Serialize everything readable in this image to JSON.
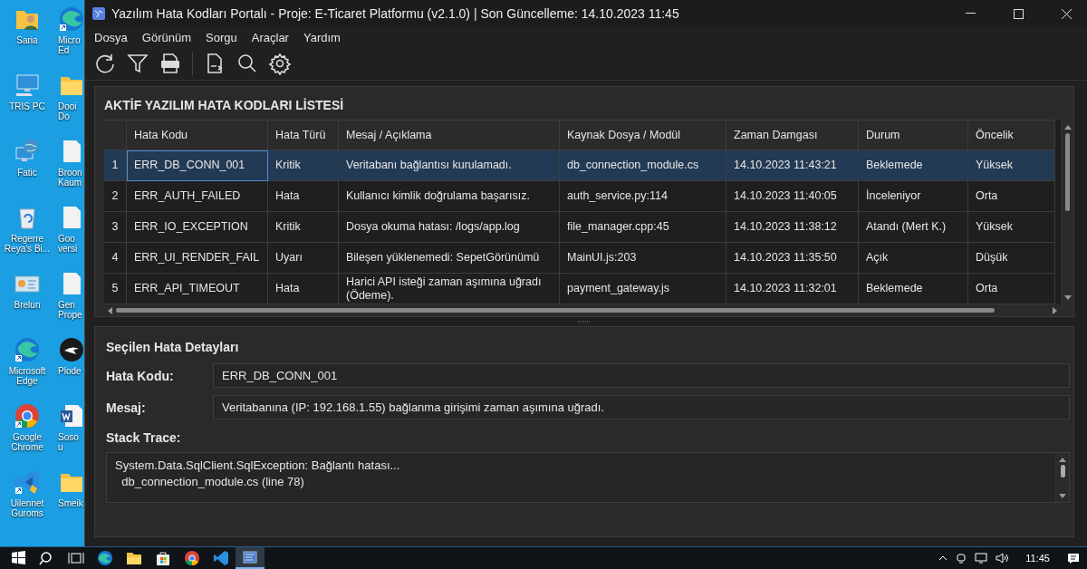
{
  "desktop": {
    "icons": [
      {
        "label": "Saria",
        "kind": "user-folder"
      },
      {
        "label": "Micro Ed",
        "kind": "edge"
      },
      {
        "label": "TRIS PC",
        "kind": "computer"
      },
      {
        "label": "Dooi Do",
        "kind": "folder"
      },
      {
        "label": "Fatic",
        "kind": "network"
      },
      {
        "label": "Broon Kaum",
        "kind": "document"
      },
      {
        "label": "Regerre Reya's Bi...",
        "kind": "recycle-bin"
      },
      {
        "label": "Goo versi",
        "kind": "document"
      },
      {
        "label": "Brelun",
        "kind": "control-panel"
      },
      {
        "label": "Gen Prope",
        "kind": "document"
      },
      {
        "label": "Microsoft Edge",
        "kind": "edge"
      },
      {
        "label": "Plode",
        "kind": "dark-app"
      },
      {
        "label": "Google Chrome",
        "kind": "chrome"
      },
      {
        "label": "Sosou",
        "kind": "word"
      },
      {
        "label": "Uilennet Guroms",
        "kind": "vscode"
      },
      {
        "label": "Smeik",
        "kind": "folder"
      }
    ]
  },
  "window": {
    "title": "Yazılım Hata Kodları Portalı - Proje: E-Ticaret Platformu (v2.1.0) | Son Güncelleme: 14.10.2023 11:45",
    "menu": [
      "Dosya",
      "Görünüm",
      "Sorgu",
      "Araçlar",
      "Yardım"
    ],
    "toolbar": [
      {
        "kind": "refresh"
      },
      {
        "kind": "filter"
      },
      {
        "kind": "pdf"
      },
      {
        "kind": "separator"
      },
      {
        "kind": "export"
      },
      {
        "kind": "search"
      },
      {
        "kind": "settings"
      }
    ]
  },
  "error_list": {
    "title": "AKTİF YAZILIM HATA KODLARI LİSTESİ",
    "columns": [
      "Hata Kodu",
      "Hata Türü",
      "Mesaj / Açıklama",
      "Kaynak Dosya / Modül",
      "Zaman Damgası",
      "Durum",
      "Öncelik"
    ],
    "rows": [
      {
        "index": "1",
        "cells": [
          "ERR_DB_CONN_001",
          "Kritik",
          "Veritabanı bağlantısı kurulamadı.",
          "db_connection_module.cs",
          "14.10.2023 11:43:21",
          "Beklemede",
          "Yüksek"
        ],
        "selected": true
      },
      {
        "index": "2",
        "cells": [
          "ERR_AUTH_FAILED",
          "Hata",
          "Kullanıcı kimlik doğrulama başarısız.",
          "auth_service.py:114",
          "14.10.2023 11:40:05",
          "İnceleniyor",
          "Orta"
        ],
        "selected": false
      },
      {
        "index": "3",
        "cells": [
          "ERR_IO_EXCEPTION",
          "Kritik",
          "Dosya okuma hatası: /logs/app.log",
          "file_manager.cpp:45",
          "14.10.2023 11:38:12",
          "Atandı (Mert K.)",
          "Yüksek"
        ],
        "selected": false
      },
      {
        "index": "4",
        "cells": [
          "ERR_UI_RENDER_FAIL",
          "Uyarı",
          "Bileşen yüklenemedi: SepetGörünümü",
          "MainUI.js:203",
          "14.10.2023 11:35:50",
          "Açık",
          "Düşük"
        ],
        "selected": false
      },
      {
        "index": "5",
        "cells": [
          "ERR_API_TIMEOUT",
          "Hata",
          "Harici API isteği zaman aşımına uğradı (Ödeme).",
          "payment_gateway.js",
          "14.10.2023 11:32:01",
          "Beklemede",
          "Orta"
        ],
        "selected": false
      }
    ]
  },
  "details": {
    "title": "Seçilen Hata Detayları",
    "code_label": "Hata Kodu:",
    "code_value": "ERR_DB_CONN_001",
    "message_label": "Mesaj:",
    "message_value": "Veritabanına (IP: 192.168.1.55) bağlanma girişimi zaman aşımına uğradı.",
    "stack_label": "Stack Trace:",
    "stack_lines": [
      "System.Data.SqlClient.SqlException: Bağlantı hatası...",
      "  db_connection_module.cs (line 78)"
    ]
  },
  "taskbar": {
    "apps": [
      {
        "kind": "start"
      },
      {
        "kind": "search"
      },
      {
        "kind": "task-view"
      },
      {
        "kind": "edge"
      },
      {
        "kind": "explorer"
      },
      {
        "kind": "store"
      },
      {
        "kind": "chrome"
      },
      {
        "kind": "vscode"
      },
      {
        "kind": "portal",
        "selected": true
      }
    ],
    "clock": "11:45"
  }
}
